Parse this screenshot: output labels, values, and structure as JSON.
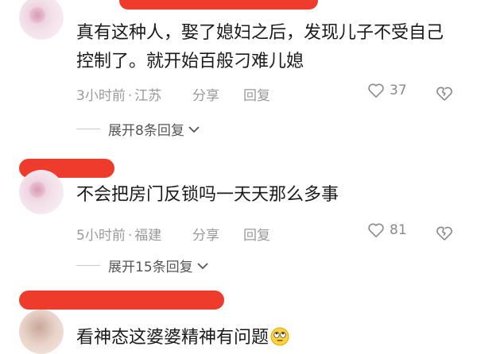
{
  "comments": [
    {
      "text": "真有这种人，娶了媳妇之后，发现儿子不受自己控制了。就开始百般刁难儿媳",
      "time": "3小时前",
      "location": "江苏",
      "share": "分享",
      "reply": "回复",
      "likes": "37",
      "expand": "展开8条回复"
    },
    {
      "text": "不会把房门反锁吗一天天那么多事",
      "time": "5小时前",
      "location": "福建",
      "share": "分享",
      "reply": "回复",
      "likes": "81",
      "expand": "展开15条回复"
    },
    {
      "text": "看神态这婆婆精神有问题"
    }
  ],
  "colors": {
    "redact": "#ef3b2c",
    "meta": "#9a9a9a"
  },
  "icons": {
    "like": "heart-outline-icon",
    "dislike": "broken-heart-icon",
    "expand": "chevron-down-icon",
    "emoji": "rolling-eyes-emoji"
  }
}
